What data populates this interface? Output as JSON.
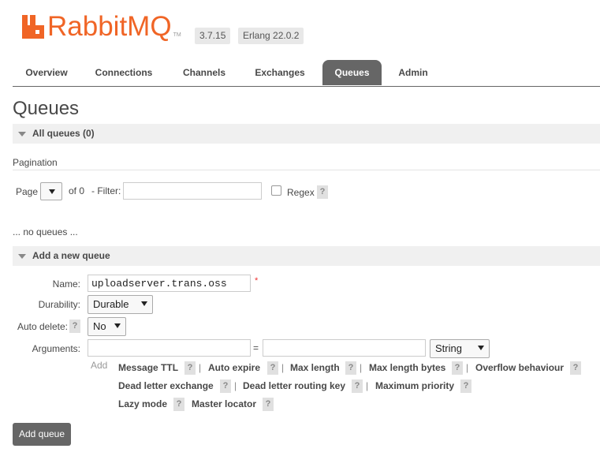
{
  "header": {
    "logo_text": "RabbitMQ",
    "logo_tm": "TM",
    "version": "3.7.15",
    "erlang": "Erlang 22.0.2",
    "brand_color": "#f06526"
  },
  "tabs": [
    {
      "label": "Overview"
    },
    {
      "label": "Connections"
    },
    {
      "label": "Channels"
    },
    {
      "label": "Exchanges"
    },
    {
      "label": "Queues"
    },
    {
      "label": "Admin"
    }
  ],
  "active_tab": "Queues",
  "page_title": "Queues",
  "all_queues": {
    "label": "All queues (0)"
  },
  "pagination": {
    "heading": "Pagination",
    "page_label": "Page",
    "of_label": "of 0",
    "filter_label": "- Filter:",
    "filter_value": "",
    "regex_label": "Regex",
    "help": "?"
  },
  "empty_message": "... no queues ...",
  "add_queue": {
    "section_label": "Add a new queue",
    "name_label": "Name:",
    "name_value": "uploadserver.trans.oss",
    "required_mark": "*",
    "durability_label": "Durability:",
    "durability_value": "Durable",
    "auto_delete_label": "Auto delete:",
    "auto_delete_value": "No",
    "arguments_label": "Arguments:",
    "arg_key": "",
    "arg_eq": "=",
    "arg_value": "",
    "arg_type": "String",
    "add_label": "Add",
    "arg_shortcuts": [
      "Message TTL",
      "Auto expire",
      "Max length",
      "Max length bytes",
      "Overflow behaviour",
      "Dead letter exchange",
      "Dead letter routing key",
      "Maximum priority",
      "Lazy mode",
      "Master locator"
    ],
    "separator": "|",
    "button_label": "Add queue"
  }
}
